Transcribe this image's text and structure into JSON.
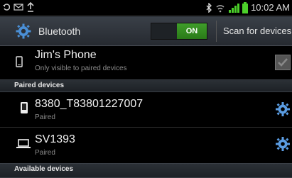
{
  "status_bar": {
    "time": "10:02 AM",
    "icons": [
      "sync-icon",
      "message-icon",
      "upload-icon",
      "bluetooth-icon",
      "wifi-icon",
      "signal-icon",
      "battery-icon"
    ]
  },
  "action_bar": {
    "title": "Bluetooth",
    "toggle_label": "ON",
    "scan_label": "Scan for devices"
  },
  "this_device": {
    "name": "Jim's Phone",
    "visibility": "Only visible to paired devices"
  },
  "paired_section": {
    "header": "Paired devices",
    "devices": [
      {
        "name": "8380_T83801227007",
        "status": "Paired",
        "icon": "phone-icon"
      },
      {
        "name": "SV1393",
        "status": "Paired",
        "icon": "laptop-icon"
      }
    ]
  },
  "available_section": {
    "header": "Available devices"
  },
  "colors": {
    "toggle_on": "#3f9e2a",
    "battery": "#4cd02a",
    "signal": "#4cd02a",
    "header_bg": "#2b3036"
  }
}
